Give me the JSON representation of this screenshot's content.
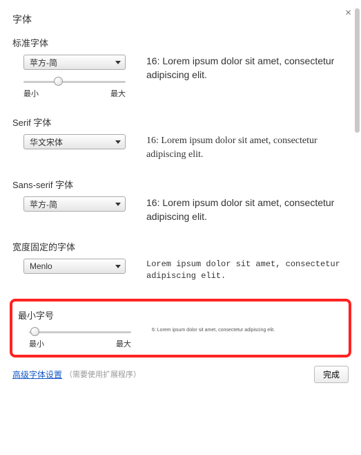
{
  "dialog": {
    "title": "字体",
    "close_glyph": "×"
  },
  "sections": {
    "standard": {
      "label": "标准字体",
      "selected": "苹方-简",
      "slider_min": "最小",
      "slider_max": "最大",
      "preview": "16: Lorem ipsum dolor sit amet, consectetur adipiscing elit."
    },
    "serif": {
      "label": "Serif 字体",
      "selected": "华文宋体",
      "preview": "16: Lorem ipsum dolor sit amet, consectetur adipiscing elit."
    },
    "sans": {
      "label": "Sans-serif 字体",
      "selected": "苹方-简",
      "preview": "16: Lorem ipsum dolor sit amet, consectetur adipiscing elit."
    },
    "fixed": {
      "label": "宽度固定的字体",
      "selected": "Menlo",
      "preview": "Lorem ipsum dolor sit amet, consectetur adipiscing elit."
    },
    "min_size": {
      "label": "最小字号",
      "slider_min": "最小",
      "slider_max": "最大",
      "preview": "6: Lorem ipsum dolor sit amet, consectetur adipiscing elit."
    }
  },
  "footer": {
    "link": "高级字体设置",
    "note": "（需要使用扩展程序）",
    "done": "完成"
  }
}
